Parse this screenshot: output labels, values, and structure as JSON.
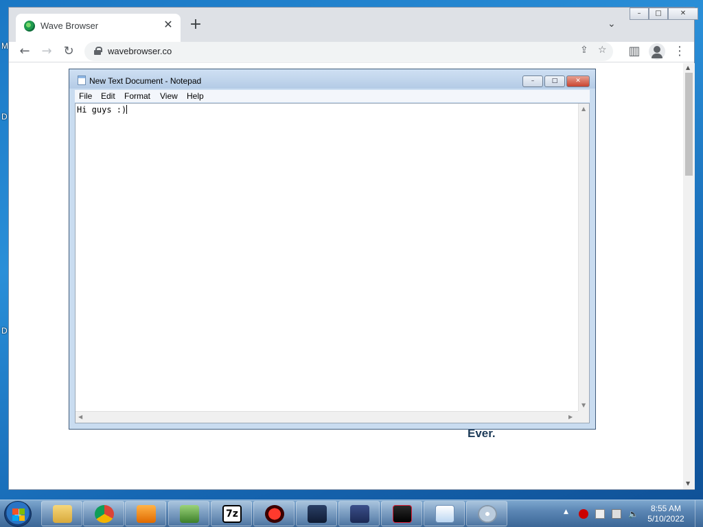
{
  "desktop": {
    "edge_letters": [
      "M",
      "D",
      "D"
    ]
  },
  "browser": {
    "tab": {
      "title": "Wave Browser",
      "close": "✕"
    },
    "new_tab": "+",
    "tab_search": "⌄",
    "window_controls": {
      "minimize": "–",
      "maximize": "□",
      "close": "✕"
    },
    "toolbar": {
      "back": "←",
      "forward": "→",
      "reload": "↻",
      "url": "wavebrowser.co",
      "share": "⇪",
      "bookmark": "☆",
      "sidepanel": "▥",
      "menu": "⋮"
    },
    "page": {
      "headline_fragment": "Ever."
    }
  },
  "notepad": {
    "title": "New Text Document - Notepad",
    "controls": {
      "minimize": "–",
      "maximize": "□",
      "close": "✕"
    },
    "menu": [
      "File",
      "Edit",
      "Format",
      "View",
      "Help"
    ],
    "content": "Hi guys :)"
  },
  "taskbar": {
    "pinned": [
      "explorer",
      "chrome",
      "media-player",
      "task-manager",
      "7zip",
      "recovery-tool",
      "vpn-shield",
      "photo-viewer",
      "screen-recorder",
      "notepad",
      "disc-burner"
    ],
    "clock": {
      "time": "8:55 AM",
      "date": "5/10/2022"
    },
    "tray_expand": "▲"
  },
  "colors": {
    "desktop": "#1a77c4",
    "taskbar": "#5b86b4",
    "notepad_frame": "#c9dcf0",
    "close_red": "#c84430"
  }
}
